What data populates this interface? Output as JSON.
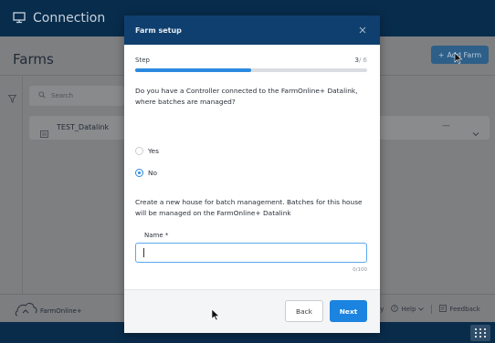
{
  "app": {
    "title": "Connection",
    "page_title": "Farms",
    "add_farm_label": "Add Farm",
    "search_placeholder": "Search",
    "farm_name": "TEST_Datalink",
    "farm_dash": "—",
    "brand_name": "FarmOnline+",
    "footer_help": "Help",
    "footer_feedback": "Feedback",
    "footer_partial": "ey"
  },
  "modal": {
    "title": "Farm setup",
    "step_label": "Step",
    "step_current": "3",
    "step_total": "/ 6",
    "progress_fraction": 0.5,
    "question": "Do you have a Controller connected to the FarmOnline+ Datalink, where batches are managed?",
    "option_yes": "Yes",
    "option_no": "No",
    "selected": "No",
    "description": "Create a new house for batch management. Batches for this house will be managed on the FarmOnline+ Datalink",
    "name_label": "Name *",
    "name_value": "",
    "char_count": "0/100",
    "back_label": "Back",
    "next_label": "Next"
  },
  "colors": {
    "header_bg": "#0f3f6e",
    "accent": "#2b8ae0",
    "next_button": "#1b84e0",
    "topbar": "#082c4c"
  },
  "icons": [
    "monitor-icon",
    "close-icon",
    "filter-icon",
    "search-icon",
    "farm-card-icon",
    "chevron-down-icon",
    "farmonline-logo-icon",
    "help-icon",
    "feedback-icon",
    "grid-icon",
    "mouse-cursor-icon"
  ]
}
